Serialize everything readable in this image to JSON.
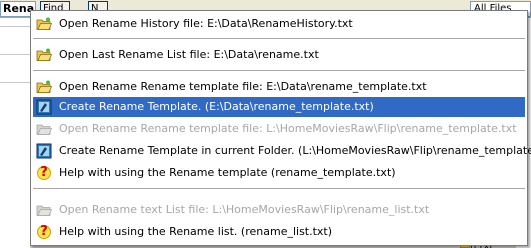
{
  "background": {
    "tab_label": "Rena",
    "find_button_label": "Find",
    "next_button_label": "N",
    "filter_combo_value": "All Files",
    "bottom_file_text": "n.txt"
  },
  "menu": {
    "items": [
      {
        "icon": "folder-open-icon",
        "label": "Open Rename History file: E:\\Data\\RenameHistory.txt",
        "enabled": true
      },
      {
        "icon": "folder-open-icon",
        "label": "Open Last Rename List file: E:\\Data\\rename.txt",
        "enabled": true
      },
      {
        "icon": "folder-open-icon",
        "label": "Open Rename Rename template file: E:\\Data\\rename_template.txt",
        "enabled": true
      },
      {
        "icon": "template-icon",
        "label": "Create Rename Template. (E:\\Data\\rename_template.txt)",
        "enabled": true,
        "selected": true
      },
      {
        "icon": "folder-open-icon",
        "label": "Open Rename Rename template file: L:\\HomeMoviesRaw\\Flip\\rename_template.txt",
        "enabled": false
      },
      {
        "icon": "template-icon",
        "label": "Create Rename Template in current Folder. (L:\\HomeMoviesRaw\\Flip\\rename_template.txt)",
        "enabled": true
      },
      {
        "icon": "help-icon",
        "label": "Help with using the Rename template (rename_template.txt)",
        "enabled": true
      },
      {
        "icon": "folder-open-icon",
        "label": "Open Rename text List file: L:\\HomeMoviesRaw\\Flip\\rename_list.txt",
        "enabled": false
      },
      {
        "icon": "help-icon",
        "label": "Help with using the Rename list. (rename_list.txt)",
        "enabled": true
      }
    ],
    "help_glyph": "?"
  },
  "colors": {
    "selection": "#316ac5",
    "disabled_text": "#a7a6aa",
    "folder": "#e9c54a"
  }
}
